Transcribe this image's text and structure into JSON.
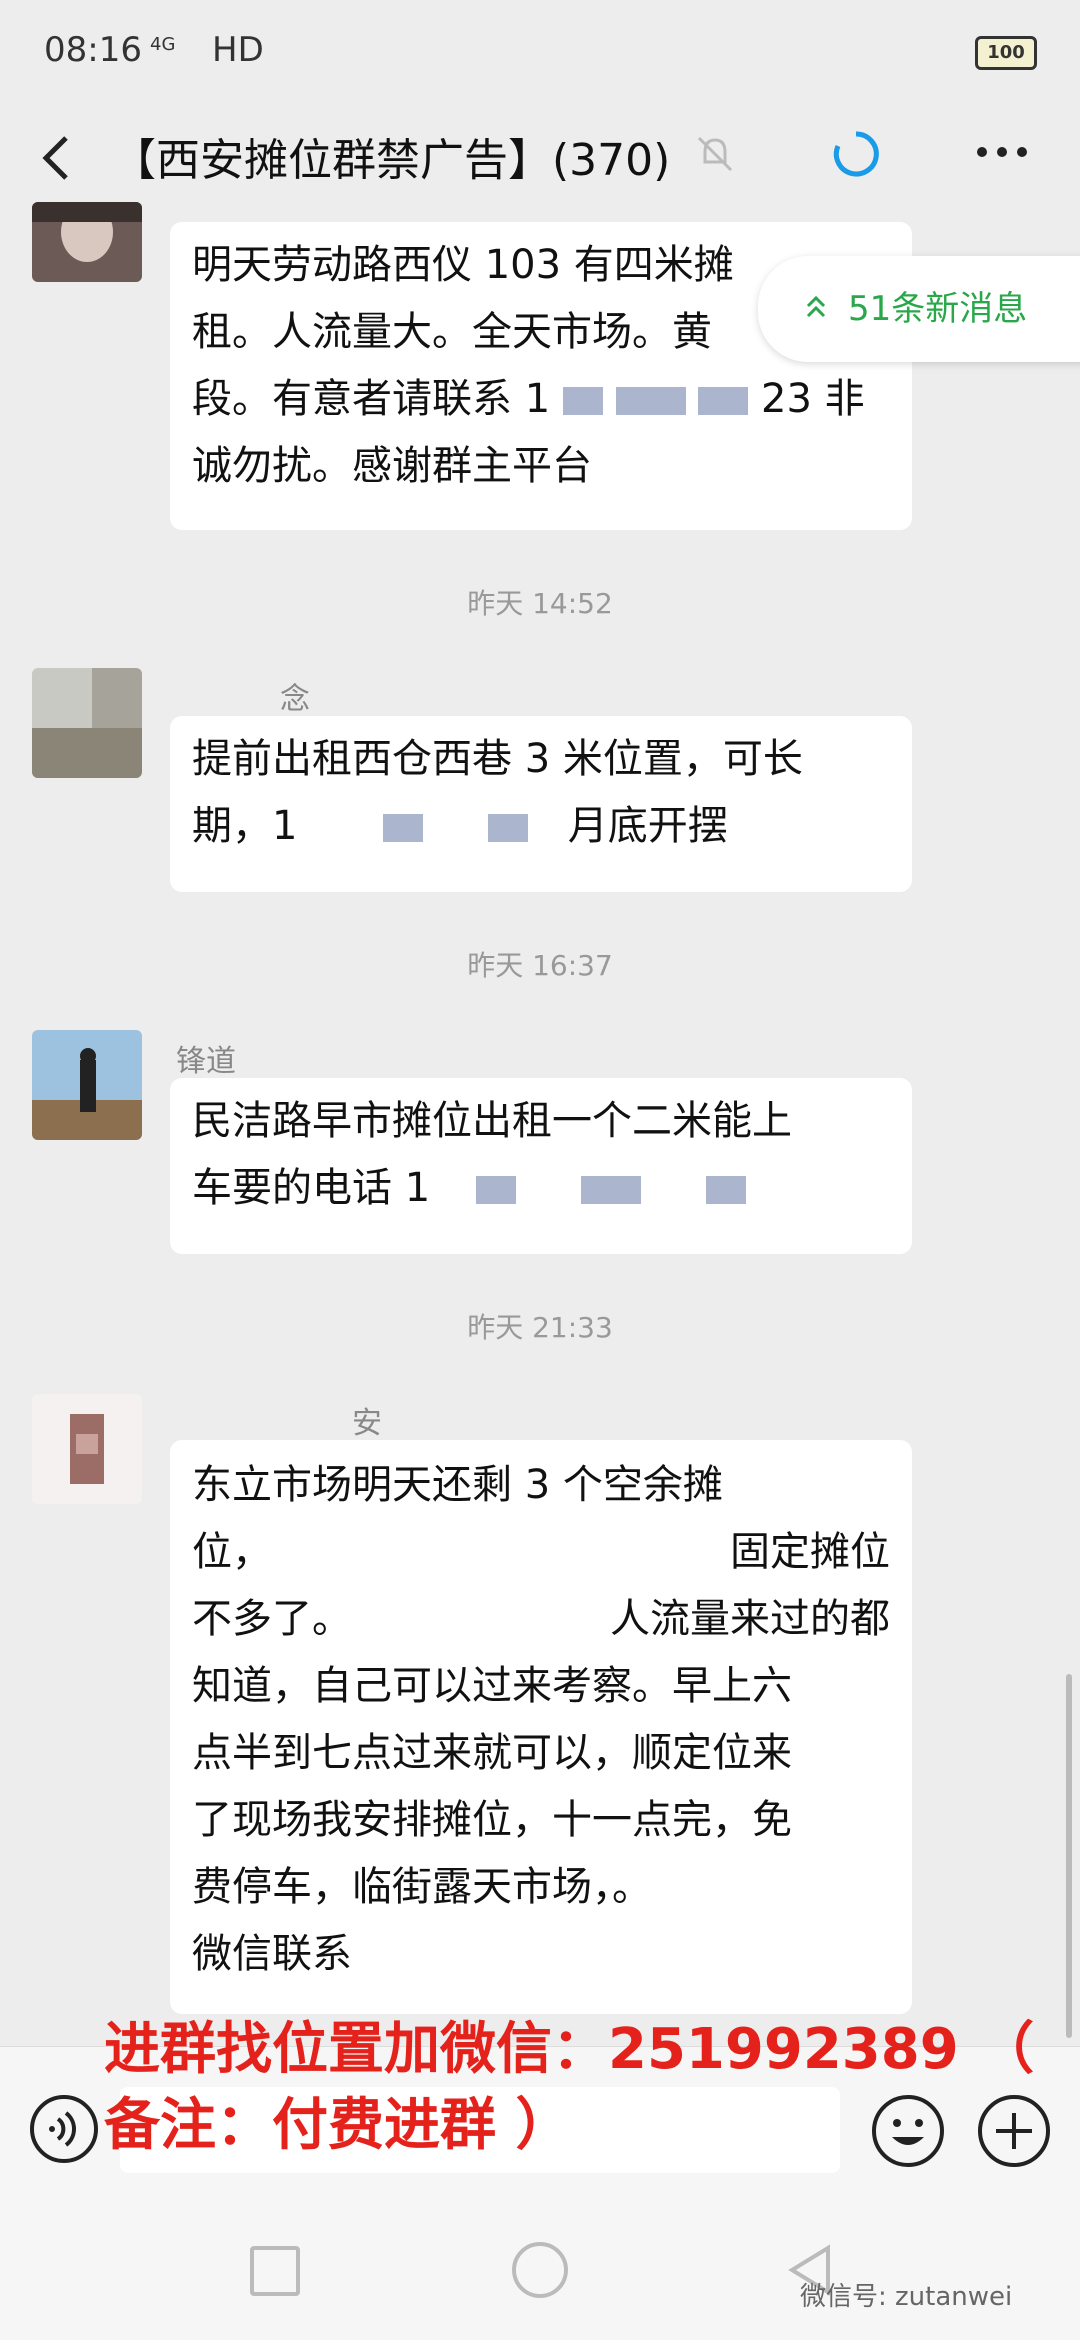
{
  "status": {
    "time": "08:16",
    "network": "4G",
    "hd": "HD",
    "battery": "100"
  },
  "header": {
    "title": "【西安摊位群禁广告】(370)"
  },
  "new_messages": {
    "label": "51条新消息"
  },
  "messages": [
    {
      "lines": [
        "明天劳动路西仪 103 有四米摊",
        "租。人流量大。全天市场。黄",
        "段。有意者请联系 1",
        "诚勿扰。感谢群主平台"
      ],
      "tail": "23 非"
    },
    {
      "sender": "念",
      "lines": [
        "提前出租西仓西巷 3 米位置，可长",
        "期，1",
        "月底开摆"
      ]
    },
    {
      "sender": "锋道",
      "lines": [
        "民洁路早市摊位出租一个二米能上",
        "车要的电话 1"
      ]
    },
    {
      "sender": "安",
      "lines": [
        "东立市场明天还剩 3 个空余摊",
        "位，",
        "固定摊位",
        "不多了。",
        "人流量来过的都",
        "知道，自己可以过来考察。早上六",
        "点半到七点过来就可以，顺定位来",
        "了现场我安排摊位，十一点完，免",
        "费停车，临街露天市场，。",
        "微信联系"
      ]
    }
  ],
  "timestamps": [
    "昨天 14:52",
    "昨天 16:37",
    "昨天 21:33"
  ],
  "promo": {
    "line1": "进群找位置加微信：251992389 （",
    "line2": "备注：付费进群 ）"
  },
  "watermark": "微信号: zutanwei",
  "colors": {
    "promo": "#e4221b",
    "new_messages": "#2aa74a",
    "refresh": "#1a9be8"
  }
}
